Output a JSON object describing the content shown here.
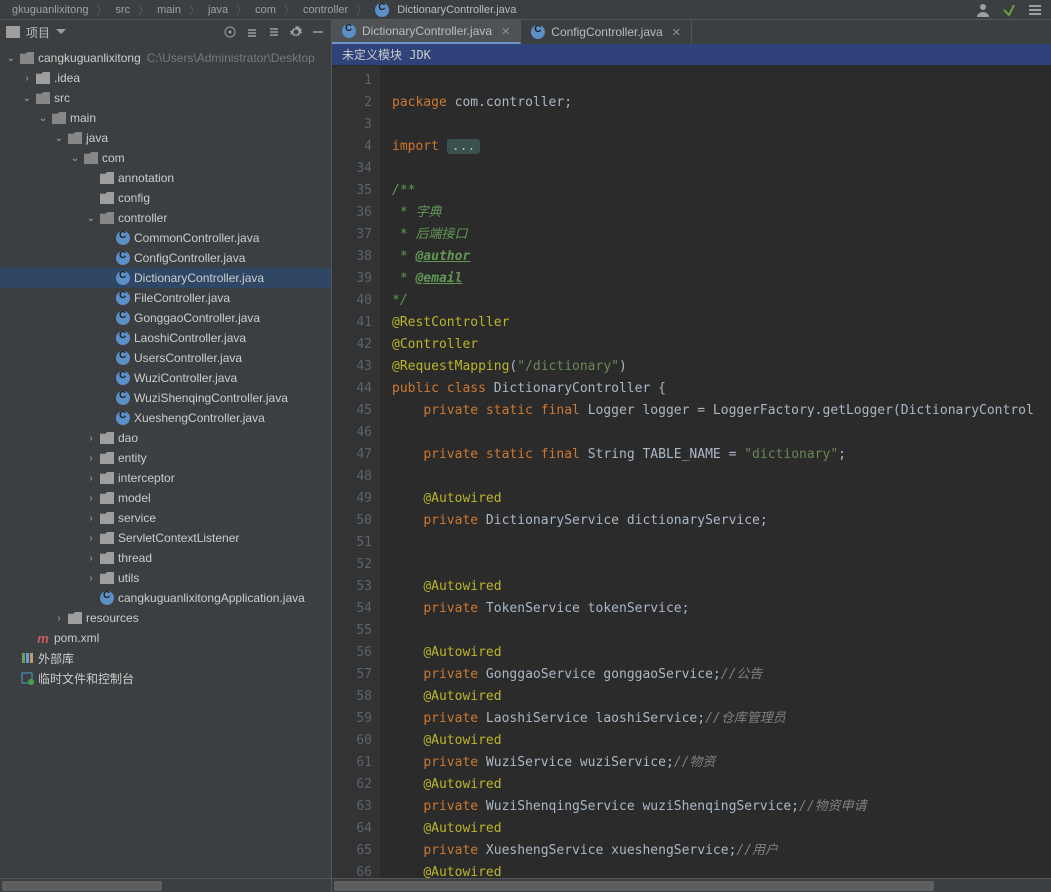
{
  "breadcrumb": [
    "gkuguanlixitong",
    "src",
    "main",
    "java",
    "com",
    "controller",
    "DictionaryController.java"
  ],
  "project_label": "项目",
  "toolbar_icons": [
    "target",
    "mini",
    "sort",
    "settings",
    "hide"
  ],
  "tabs": [
    {
      "name": "DictionaryController.java",
      "active": true
    },
    {
      "name": "ConfigController.java",
      "active": false
    }
  ],
  "banner": "未定义模块 JDK",
  "tree": [
    {
      "depth": 0,
      "arrow": "down",
      "icon": "folder",
      "label": "cangkuguanlixitong",
      "ext": "C:\\Users\\Administrator\\Desktop"
    },
    {
      "depth": 1,
      "arrow": "right",
      "icon": "folder",
      "label": ".idea"
    },
    {
      "depth": 1,
      "arrow": "down",
      "icon": "folder",
      "label": "src"
    },
    {
      "depth": 2,
      "arrow": "down",
      "icon": "folder",
      "label": "main"
    },
    {
      "depth": 3,
      "arrow": "down",
      "icon": "folder",
      "label": "java"
    },
    {
      "depth": 4,
      "arrow": "down",
      "icon": "folder",
      "label": "com"
    },
    {
      "depth": 5,
      "arrow": "",
      "icon": "folder",
      "label": "annotation"
    },
    {
      "depth": 5,
      "arrow": "",
      "icon": "folder",
      "label": "config"
    },
    {
      "depth": 5,
      "arrow": "down",
      "icon": "folder",
      "label": "controller"
    },
    {
      "depth": 6,
      "arrow": "",
      "icon": "class",
      "label": "CommonController.java"
    },
    {
      "depth": 6,
      "arrow": "",
      "icon": "class",
      "label": "ConfigController.java"
    },
    {
      "depth": 6,
      "arrow": "",
      "icon": "class",
      "label": "DictionaryController.java",
      "selected": true
    },
    {
      "depth": 6,
      "arrow": "",
      "icon": "class",
      "label": "FileController.java"
    },
    {
      "depth": 6,
      "arrow": "",
      "icon": "class",
      "label": "GonggaoController.java"
    },
    {
      "depth": 6,
      "arrow": "",
      "icon": "class",
      "label": "LaoshiController.java"
    },
    {
      "depth": 6,
      "arrow": "",
      "icon": "class",
      "label": "UsersController.java"
    },
    {
      "depth": 6,
      "arrow": "",
      "icon": "class",
      "label": "WuziController.java"
    },
    {
      "depth": 6,
      "arrow": "",
      "icon": "class",
      "label": "WuziShenqingController.java"
    },
    {
      "depth": 6,
      "arrow": "",
      "icon": "class",
      "label": "XueshengController.java"
    },
    {
      "depth": 5,
      "arrow": "right",
      "icon": "folder",
      "label": "dao"
    },
    {
      "depth": 5,
      "arrow": "right",
      "icon": "folder",
      "label": "entity"
    },
    {
      "depth": 5,
      "arrow": "right",
      "icon": "folder",
      "label": "interceptor"
    },
    {
      "depth": 5,
      "arrow": "right",
      "icon": "folder",
      "label": "model"
    },
    {
      "depth": 5,
      "arrow": "right",
      "icon": "folder",
      "label": "service"
    },
    {
      "depth": 5,
      "arrow": "right",
      "icon": "folder",
      "label": "ServletContextListener"
    },
    {
      "depth": 5,
      "arrow": "right",
      "icon": "folder",
      "label": "thread"
    },
    {
      "depth": 5,
      "arrow": "right",
      "icon": "folder",
      "label": "utils"
    },
    {
      "depth": 5,
      "arrow": "",
      "icon": "class",
      "label": "cangkuguanlixitongApplication.java"
    },
    {
      "depth": 3,
      "arrow": "right",
      "icon": "folder",
      "label": "resources"
    },
    {
      "depth": 1,
      "arrow": "",
      "icon": "mvn",
      "label": "pom.xml"
    },
    {
      "depth": 0,
      "arrow": "",
      "icon": "lib",
      "label": "外部库"
    },
    {
      "depth": 0,
      "arrow": "",
      "icon": "scratch",
      "label": "临时文件和控制台"
    }
  ],
  "code": {
    "lines": [
      {
        "n": "1",
        "html": ""
      },
      {
        "n": "2",
        "html": "<span class='kw'>package</span> com.controller;"
      },
      {
        "n": "3",
        "html": ""
      },
      {
        "n": "4",
        "html": "<span class='kw'>import</span> <span class='fold'>...</span>"
      },
      {
        "n": "34",
        "html": ""
      },
      {
        "n": "35",
        "html": "<span class='cmt-bl'>/**</span>"
      },
      {
        "n": "36",
        "html": "<span class='cmt-bl'> * 字典</span>"
      },
      {
        "n": "37",
        "html": "<span class='cmt-bl'> * 后端接口</span>"
      },
      {
        "n": "38",
        "html": "<span class='cmt-bl'> * <span class='tag'>@author</span></span>"
      },
      {
        "n": "39",
        "html": "<span class='cmt-bl'> * <span class='tag'>@email</span></span>"
      },
      {
        "n": "40",
        "html": "<span class='cmt-bl'>*/</span>"
      },
      {
        "n": "41",
        "html": "<span class='ann'>@RestController</span>"
      },
      {
        "n": "42",
        "html": "<span class='ann'>@Controller</span>"
      },
      {
        "n": "43",
        "html": "<span class='ann'>@RequestMapping</span>(<span class='str'>\"/dictionary\"</span>)"
      },
      {
        "n": "44",
        "html": "<span class='kw'>public class </span>DictionaryController {"
      },
      {
        "n": "45",
        "html": "    <span class='kw'>private static final </span>Logger logger = LoggerFactory.getLogger(DictionaryControl"
      },
      {
        "n": "46",
        "html": ""
      },
      {
        "n": "47",
        "html": "    <span class='kw'>private static final </span>String TABLE_NAME = <span class='str'>\"dictionary\"</span>;"
      },
      {
        "n": "48",
        "html": ""
      },
      {
        "n": "49",
        "html": "    <span class='ann'>@Autowired</span>"
      },
      {
        "n": "50",
        "html": "    <span class='kw'>private</span> DictionaryService dictionaryService;"
      },
      {
        "n": "51",
        "html": ""
      },
      {
        "n": "52",
        "html": ""
      },
      {
        "n": "53",
        "html": "    <span class='ann'>@Autowired</span>"
      },
      {
        "n": "54",
        "html": "    <span class='kw'>private</span> TokenService tokenService;"
      },
      {
        "n": "55",
        "html": ""
      },
      {
        "n": "56",
        "html": "    <span class='ann'>@Autowired</span>"
      },
      {
        "n": "57",
        "html": "    <span class='kw'>private</span> GonggaoService gonggaoService;<span class='cmt'>//公告</span>"
      },
      {
        "n": "58",
        "html": "    <span class='ann'>@Autowired</span>"
      },
      {
        "n": "59",
        "html": "    <span class='kw'>private</span> LaoshiService laoshiService;<span class='cmt'>//仓库管理员</span>"
      },
      {
        "n": "60",
        "html": "    <span class='ann'>@Autowired</span>"
      },
      {
        "n": "61",
        "html": "    <span class='kw'>private</span> WuziService wuziService;<span class='cmt'>//物资</span>"
      },
      {
        "n": "62",
        "html": "    <span class='ann'>@Autowired</span>"
      },
      {
        "n": "63",
        "html": "    <span class='kw'>private</span> WuziShenqingService wuziShenqingService;<span class='cmt'>//物资申请</span>"
      },
      {
        "n": "64",
        "html": "    <span class='ann'>@Autowired</span>"
      },
      {
        "n": "65",
        "html": "    <span class='kw'>private</span> XueshengService xueshengService;<span class='cmt'>//用户</span>"
      },
      {
        "n": "66",
        "html": "    <span class='ann'>@Autowired</span>"
      }
    ]
  }
}
